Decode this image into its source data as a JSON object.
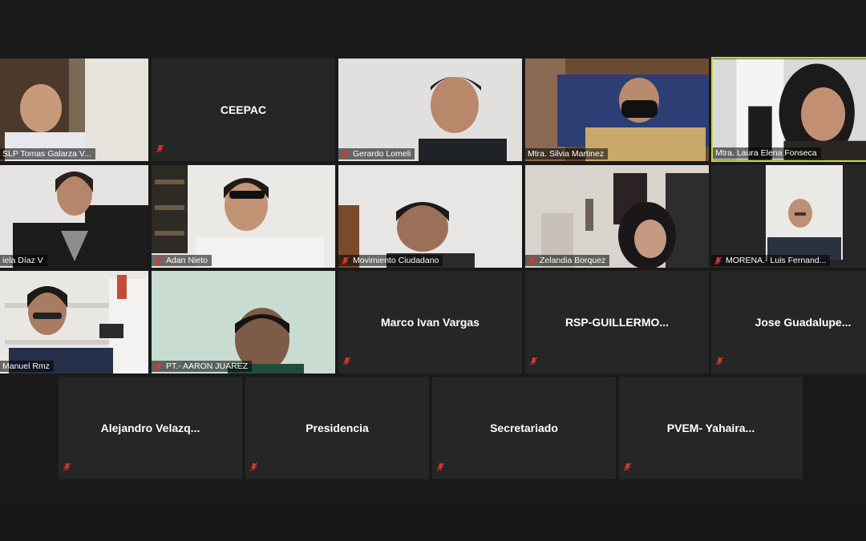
{
  "participants": {
    "t1": "SLP Tomas Galarza V...",
    "t2": "CEEPAC",
    "t3": "Gerardo Lomeli",
    "t4": "Mtra. Silvia Martinez",
    "t5": "Mtra. Laura Elena Fonseca",
    "t6": "iela Díaz V",
    "t7": "Adan Nieto",
    "t8": "Movimiento Ciudadano",
    "t9": "Zelandia Borquez",
    "t10": "MORENA.- Luis Fernand...",
    "t11": "Manuel Rmz",
    "t12": "PT.- AARON JUAREZ",
    "t13": "Marco Ivan Vargas",
    "t14": "RSP-GUILLERMO...",
    "t15": "Jose Guadalupe...",
    "t16": "Alejandro Velazq...",
    "t17": "Presidencia",
    "t18": "Secretariado",
    "t19": "PVEM- Yahaira..."
  },
  "colors": {
    "background": "#1a1a1a",
    "tile": "#262626",
    "active_speaker_border": "#c8d93a",
    "muted_icon": "#e0352b"
  },
  "icons": {
    "mute": "muted-microphone-icon"
  }
}
